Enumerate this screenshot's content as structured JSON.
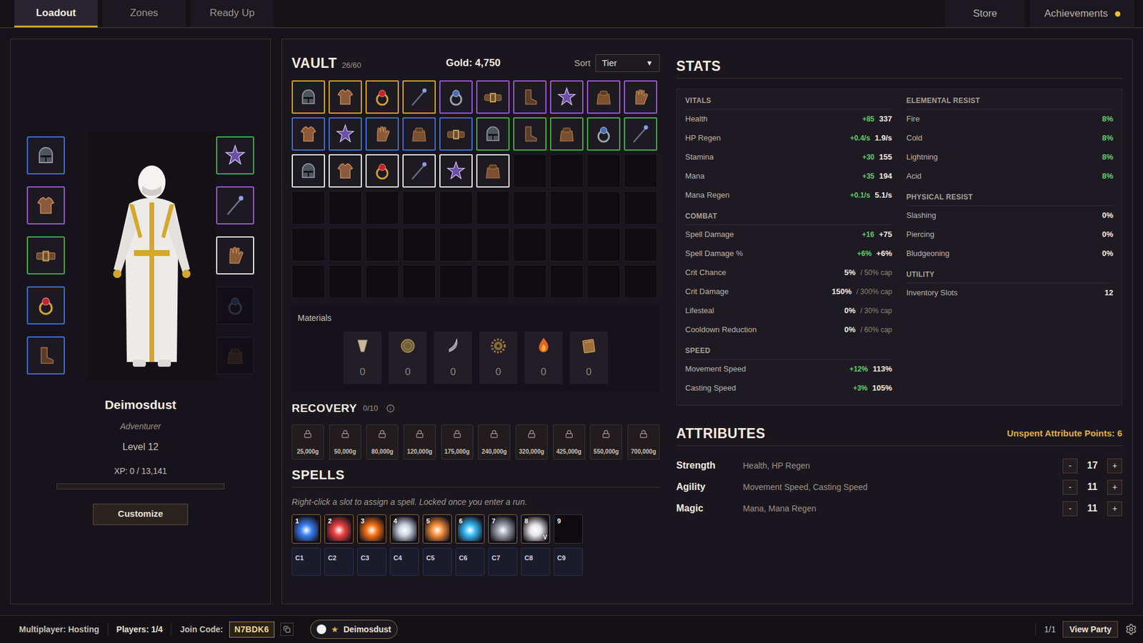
{
  "nav": {
    "tabs": [
      {
        "label": "Loadout",
        "selected": true
      },
      {
        "label": "Zones",
        "selected": false
      },
      {
        "label": "Ready Up",
        "selected": false
      }
    ],
    "links": [
      {
        "label": "Store",
        "badge": false
      },
      {
        "label": "Achievements",
        "badge": true
      }
    ]
  },
  "character": {
    "left_slots": [
      {
        "kind": "helmet",
        "color": "#3f6fd0",
        "empty": false
      },
      {
        "kind": "chest",
        "color": "#9b59d6",
        "empty": false
      },
      {
        "kind": "belt",
        "color": "#3fb04a",
        "empty": false
      },
      {
        "kind": "ring-ruby",
        "color": "#3f6fd0",
        "empty": false
      },
      {
        "kind": "boots",
        "color": "#3f6fd0",
        "empty": false
      }
    ],
    "right_slots": [
      {
        "kind": "amulet",
        "color": "#3fb04a",
        "empty": false
      },
      {
        "kind": "staff",
        "color": "#9b59d6",
        "empty": false
      },
      {
        "kind": "gloves",
        "color": "#e8e8e8",
        "empty": false
      },
      {
        "kind": "ring-silver",
        "color": "#1e1a22",
        "empty": true
      },
      {
        "kind": "pack",
        "color": "#1e1a22",
        "empty": true
      }
    ],
    "name": "Deimosdust",
    "title": "Adventurer",
    "level": "Level 12",
    "xp": "XP: 0 / 13,141",
    "xp_level": 0,
    "customize": "Customize"
  },
  "vault": {
    "title": "VAULT",
    "count": "26/60",
    "capacity": 60,
    "gold": "Gold: 4,750",
    "sort_label": "Sort",
    "sort_value": "Tier",
    "sort_arrow": "▼",
    "items": [
      {
        "kind": "helmet",
        "color": "#d9a520"
      },
      {
        "kind": "chest",
        "color": "#d9a520"
      },
      {
        "kind": "ring-ruby",
        "color": "#d9a520"
      },
      {
        "kind": "staff",
        "color": "#d9a520"
      },
      {
        "kind": "ring-silver",
        "color": "#9b59d6"
      },
      {
        "kind": "belt",
        "color": "#9b59d6"
      },
      {
        "kind": "boots",
        "color": "#9b59d6"
      },
      {
        "kind": "amulet",
        "color": "#9b59d6"
      },
      {
        "kind": "pack",
        "color": "#9b59d6"
      },
      {
        "kind": "gloves",
        "color": "#9b59d6"
      },
      {
        "kind": "chest",
        "color": "#3f6fd0"
      },
      {
        "kind": "amulet",
        "color": "#3f6fd0"
      },
      {
        "kind": "gloves",
        "color": "#3f6fd0"
      },
      {
        "kind": "pack",
        "color": "#3f6fd0"
      },
      {
        "kind": "belt",
        "color": "#3f6fd0"
      },
      {
        "kind": "helmet",
        "color": "#3fb04a"
      },
      {
        "kind": "boots",
        "color": "#3fb04a"
      },
      {
        "kind": "pack",
        "color": "#3fb04a"
      },
      {
        "kind": "ring-silver",
        "color": "#3fb04a"
      },
      {
        "kind": "staff",
        "color": "#3fb04a"
      },
      {
        "kind": "helmet",
        "color": "#e8e8e8"
      },
      {
        "kind": "chest",
        "color": "#e8e8e8"
      },
      {
        "kind": "ring-ruby",
        "color": "#e8e8e8"
      },
      {
        "kind": "staff",
        "color": "#e8e8e8"
      },
      {
        "kind": "amulet",
        "color": "#e8e8e8"
      },
      {
        "kind": "pack",
        "color": "#e8e8e8"
      }
    ]
  },
  "materials": {
    "title": "Materials",
    "items": [
      {
        "kind": "horn",
        "count": "0"
      },
      {
        "kind": "coin",
        "count": "0"
      },
      {
        "kind": "claw",
        "count": "0"
      },
      {
        "kind": "gear",
        "count": "0"
      },
      {
        "kind": "flame",
        "count": "0"
      },
      {
        "kind": "book",
        "count": "0"
      }
    ]
  },
  "recovery": {
    "title": "RECOVERY",
    "count": "0/10",
    "slots": [
      {
        "price": "25,000g",
        "locked": true
      },
      {
        "price": "50,000g",
        "locked": true
      },
      {
        "price": "80,000g",
        "locked": true
      },
      {
        "price": "120,000g",
        "locked": true
      },
      {
        "price": "175,000g",
        "locked": true
      },
      {
        "price": "240,000g",
        "locked": true
      },
      {
        "price": "320,000g",
        "locked": true
      },
      {
        "price": "425,000g",
        "locked": true
      },
      {
        "price": "550,000g",
        "locked": true
      },
      {
        "price": "700,000g",
        "locked": true
      }
    ]
  },
  "spells": {
    "title": "SPELLS",
    "hint": "Right-click a slot to assign a spell. Locked once you enter a run.",
    "slots": [
      {
        "key": "1",
        "color": "#3b82f6",
        "empty": false,
        "badge": ""
      },
      {
        "key": "2",
        "color": "#ef4444",
        "empty": false,
        "badge": ""
      },
      {
        "key": "3",
        "color": "#f97316",
        "empty": false,
        "badge": ""
      },
      {
        "key": "4",
        "color": "#cbd5e1",
        "empty": false,
        "badge": ""
      },
      {
        "key": "5",
        "color": "#fb923c",
        "empty": false,
        "badge": ""
      },
      {
        "key": "6",
        "color": "#38bdf8",
        "empty": false,
        "badge": ""
      },
      {
        "key": "7",
        "color": "#9ca3af",
        "empty": false,
        "badge": ""
      },
      {
        "key": "8",
        "color": "#e5e7eb",
        "empty": false,
        "badge": "V"
      },
      {
        "key": "9",
        "color": "#000000",
        "empty": true,
        "badge": ""
      }
    ],
    "combo_slots": [
      {
        "key": "C1"
      },
      {
        "key": "C2"
      },
      {
        "key": "C3"
      },
      {
        "key": "C4"
      },
      {
        "key": "C5"
      },
      {
        "key": "C6"
      },
      {
        "key": "C7"
      },
      {
        "key": "C8"
      },
      {
        "key": "C9"
      }
    ]
  },
  "stats": {
    "title": "STATS",
    "left": [
      {
        "heading": "VITALS",
        "rows": [
          {
            "label": "Health",
            "bonus": "+85",
            "value": "337",
            "cap": "",
            "highlight": false
          },
          {
            "label": "HP Regen",
            "bonus": "+0.4/s",
            "value": "1.9/s",
            "cap": "",
            "highlight": false
          },
          {
            "label": "Stamina",
            "bonus": "+30",
            "value": "155",
            "cap": "",
            "highlight": false
          },
          {
            "label": "Mana",
            "bonus": "+35",
            "value": "194",
            "cap": "",
            "highlight": false
          },
          {
            "label": "Mana Regen",
            "bonus": "+0.1/s",
            "value": "5.1/s",
            "cap": "",
            "highlight": false
          }
        ]
      },
      {
        "heading": "COMBAT",
        "rows": [
          {
            "label": "Spell Damage",
            "bonus": "+16",
            "value": "+75",
            "cap": "",
            "highlight": false
          },
          {
            "label": "Spell Damage %",
            "bonus": "+6%",
            "value": "+6%",
            "cap": "",
            "highlight": false
          },
          {
            "label": "Crit Chance",
            "bonus": "",
            "value": "5%",
            "cap": "/ 50% cap",
            "highlight": false
          },
          {
            "label": "Crit Damage",
            "bonus": "",
            "value": "150%",
            "cap": "/ 300% cap",
            "highlight": false
          },
          {
            "label": "Lifesteal",
            "bonus": "",
            "value": "0%",
            "cap": "/ 30% cap",
            "highlight": false
          },
          {
            "label": "Cooldown Reduction",
            "bonus": "",
            "value": "0%",
            "cap": "/ 60% cap",
            "highlight": false
          }
        ]
      },
      {
        "heading": "SPEED",
        "rows": [
          {
            "label": "Movement Speed",
            "bonus": "+12%",
            "value": "113%",
            "cap": "",
            "highlight": false
          },
          {
            "label": "Casting Speed",
            "bonus": "+3%",
            "value": "105%",
            "cap": "",
            "highlight": false
          }
        ]
      }
    ],
    "right": [
      {
        "heading": "ELEMENTAL RESIST",
        "rows": [
          {
            "label": "Fire",
            "bonus": "",
            "value": "8%",
            "cap": "",
            "highlight": true
          },
          {
            "label": "Cold",
            "bonus": "",
            "value": "8%",
            "cap": "",
            "highlight": true
          },
          {
            "label": "Lightning",
            "bonus": "",
            "value": "8%",
            "cap": "",
            "highlight": true
          },
          {
            "label": "Acid",
            "bonus": "",
            "value": "8%",
            "cap": "",
            "highlight": true
          }
        ]
      },
      {
        "heading": "PHYSICAL RESIST",
        "rows": [
          {
            "label": "Slashing",
            "bonus": "",
            "value": "0%",
            "cap": "",
            "highlight": false
          },
          {
            "label": "Piercing",
            "bonus": "",
            "value": "0%",
            "cap": "",
            "highlight": false
          },
          {
            "label": "Bludgeoning",
            "bonus": "",
            "value": "0%",
            "cap": "",
            "highlight": false
          }
        ]
      },
      {
        "heading": "UTILITY",
        "rows": [
          {
            "label": "Inventory Slots",
            "bonus": "",
            "value": "12",
            "cap": "",
            "highlight": false
          }
        ]
      }
    ]
  },
  "attributes": {
    "title": "ATTRIBUTES",
    "unspent": "Unspent Attribute Points: 6",
    "rows": [
      {
        "name": "Strength",
        "effects": "Health, HP Regen",
        "value": "17",
        "minus": "-",
        "plus": "+"
      },
      {
        "name": "Agility",
        "effects": "Movement Speed, Casting Speed",
        "value": "11",
        "minus": "-",
        "plus": "+"
      },
      {
        "name": "Magic",
        "effects": "Mana, Mana Regen",
        "value": "11",
        "minus": "-",
        "plus": "+"
      }
    ]
  },
  "status_bar": {
    "mode": "Multiplayer: Hosting",
    "players": "Players: 1/4",
    "join_label": "Join Code:",
    "join_code": "N7BDK6",
    "player": {
      "star": "★",
      "name": "Deimosdust",
      "ready": false
    },
    "page": "1/1",
    "button": "View Party"
  }
}
